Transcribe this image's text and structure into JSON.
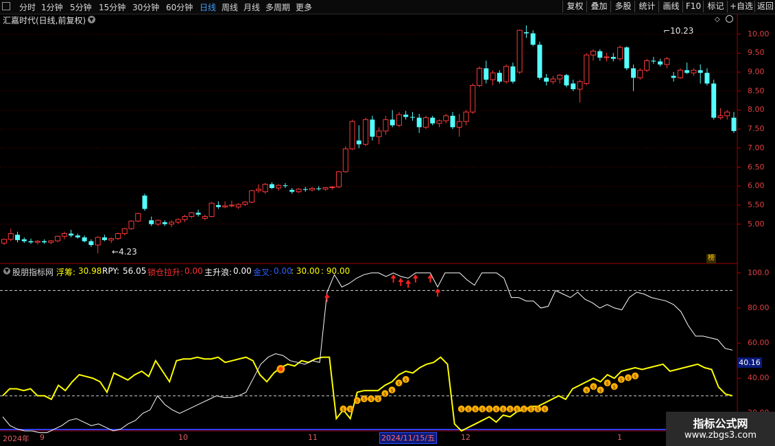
{
  "toolbar": {
    "periods": [
      "分时",
      "1分钟",
      "5分钟",
      "15分钟",
      "30分钟",
      "60分钟",
      "日线",
      "周线",
      "月线",
      "多周期",
      "更多"
    ],
    "active": "日线",
    "buttons": [
      "复权",
      "叠加",
      "多股",
      "统计",
      "画线",
      "F10",
      "标记",
      "+自选",
      "返回"
    ]
  },
  "main_chart": {
    "title": "汇嘉时代(日线,前复权)",
    "high_label": "10.23",
    "low_label": "4.23",
    "badge": "榜",
    "y_ticks": [
      "10.00",
      "9.50",
      "9.00",
      "8.50",
      "8.00",
      "7.50",
      "7.00",
      "6.50",
      "6.00",
      "5.50",
      "5.00"
    ]
  },
  "indicator": {
    "name": "股朋指标网",
    "fuchou_label": "浮筹:",
    "fuchou_value": "30.98",
    "rpy_label": "RPY:",
    "rpy_value": "56.05",
    "suocang_label": "锁仓拉升:",
    "suocang_value": "0.00",
    "zhushenglang_label": "主升浪:",
    "zhushenglang_value": "0.00",
    "jincha_label": "金叉:",
    "jincha_value": "0.00",
    "level1": ": 30.00",
    "level2": ": 90.00",
    "y_ticks": [
      "100.0",
      "80.00",
      "60.00",
      "40.00",
      "20.00"
    ],
    "current_value": "40.16"
  },
  "date_axis": {
    "year": "2024年",
    "months": [
      "9",
      "10",
      "11",
      "12",
      "1"
    ],
    "cursor_date": "2024/11/15/五"
  },
  "watermark": {
    "line1": "指标公式网",
    "line2": "www.zbgs3.com"
  },
  "colors": {
    "up": "#ff3a3a",
    "down": "#54ffff",
    "yellow": "#ffff00",
    "white": "#ffffff",
    "axis": "#c00000"
  },
  "chart_data": [
    {
      "type": "candlestick",
      "title": "汇嘉时代(日线,前复权)",
      "ylim": [
        4.0,
        10.5
      ],
      "annotations": {
        "max": 10.23,
        "min": 4.23
      },
      "candles": [
        [
          4.5,
          4.62,
          4.45,
          4.6
        ],
        [
          4.6,
          4.88,
          4.55,
          4.75
        ],
        [
          4.72,
          4.8,
          4.52,
          4.58
        ],
        [
          4.6,
          4.65,
          4.5,
          4.55
        ],
        [
          4.55,
          4.62,
          4.48,
          4.52
        ],
        [
          4.52,
          4.58,
          4.46,
          4.55
        ],
        [
          4.55,
          4.6,
          4.48,
          4.52
        ],
        [
          4.52,
          4.58,
          4.47,
          4.56
        ],
        [
          4.56,
          4.7,
          4.52,
          4.68
        ],
        [
          4.68,
          4.8,
          4.6,
          4.75
        ],
        [
          4.75,
          4.85,
          4.65,
          4.7
        ],
        [
          4.7,
          4.75,
          4.62,
          4.65
        ],
        [
          4.65,
          4.7,
          4.52,
          4.55
        ],
        [
          4.55,
          4.6,
          4.4,
          4.45
        ],
        [
          4.45,
          4.68,
          4.23,
          4.65
        ],
        [
          4.65,
          4.72,
          4.55,
          4.58
        ],
        [
          4.58,
          4.65,
          4.5,
          4.62
        ],
        [
          4.62,
          4.78,
          4.58,
          4.75
        ],
        [
          4.75,
          4.9,
          4.7,
          4.88
        ],
        [
          4.88,
          5.1,
          4.85,
          5.08
        ],
        [
          5.08,
          5.3,
          5.05,
          5.28
        ],
        [
          5.75,
          5.8,
          5.35,
          5.4
        ],
        [
          5.1,
          5.2,
          4.95,
          5.0
        ],
        [
          5.0,
          5.12,
          4.95,
          5.1
        ],
        [
          5.05,
          5.1,
          4.95,
          5.0
        ],
        [
          5.0,
          5.1,
          4.92,
          5.05
        ],
        [
          5.05,
          5.15,
          5.0,
          5.12
        ],
        [
          5.12,
          5.25,
          5.05,
          5.2
        ],
        [
          5.2,
          5.32,
          5.15,
          5.3
        ],
        [
          5.3,
          5.38,
          5.2,
          5.25
        ],
        [
          5.15,
          5.25,
          5.1,
          5.2
        ],
        [
          5.2,
          5.58,
          5.18,
          5.55
        ],
        [
          5.5,
          5.6,
          5.4,
          5.45
        ],
        [
          5.45,
          5.6,
          5.42,
          5.48
        ],
        [
          5.48,
          5.62,
          5.44,
          5.5
        ],
        [
          5.45,
          5.55,
          5.4,
          5.52
        ],
        [
          5.52,
          5.6,
          5.48,
          5.58
        ],
        [
          5.58,
          5.9,
          5.55,
          5.88
        ],
        [
          5.88,
          6.05,
          5.82,
          5.92
        ],
        [
          5.85,
          6.08,
          5.8,
          6.05
        ],
        [
          6.05,
          6.1,
          5.92,
          5.95
        ],
        [
          5.95,
          6.05,
          5.88,
          6.02
        ],
        [
          6.02,
          6.08,
          5.95,
          6.0
        ],
        [
          5.9,
          5.95,
          5.8,
          5.85
        ],
        [
          5.85,
          5.95,
          5.82,
          5.92
        ],
        [
          5.92,
          5.98,
          5.85,
          5.9
        ],
        [
          5.9,
          5.98,
          5.86,
          5.94
        ],
        [
          5.94,
          6.0,
          5.88,
          5.92
        ],
        [
          5.92,
          5.98,
          5.88,
          5.96
        ],
        [
          5.96,
          6.0,
          5.9,
          5.98
        ],
        [
          5.98,
          6.4,
          5.95,
          6.38
        ],
        [
          6.38,
          7.05,
          6.35,
          6.98
        ],
        [
          6.98,
          7.75,
          6.95,
          7.7
        ],
        [
          7.2,
          7.6,
          7.0,
          7.1
        ],
        [
          7.1,
          7.8,
          7.05,
          7.75
        ],
        [
          7.75,
          7.85,
          7.2,
          7.3
        ],
        [
          7.3,
          7.55,
          7.1,
          7.45
        ],
        [
          7.45,
          7.85,
          7.35,
          7.75
        ],
        [
          7.75,
          8.0,
          7.55,
          7.6
        ],
        [
          7.6,
          7.95,
          7.55,
          7.88
        ],
        [
          7.88,
          7.98,
          7.75,
          7.82
        ],
        [
          7.82,
          7.95,
          7.72,
          7.8
        ],
        [
          7.8,
          7.9,
          7.4,
          7.55
        ],
        [
          7.55,
          7.85,
          7.5,
          7.8
        ],
        [
          7.8,
          7.85,
          7.6,
          7.65
        ],
        [
          7.65,
          7.75,
          7.55,
          7.72
        ],
        [
          7.72,
          7.9,
          7.65,
          7.85
        ],
        [
          7.85,
          7.95,
          7.5,
          7.55
        ],
        [
          7.55,
          7.9,
          7.3,
          7.7
        ],
        [
          7.7,
          8.0,
          7.6,
          7.95
        ],
        [
          7.95,
          8.7,
          7.9,
          8.65
        ],
        [
          8.65,
          9.15,
          8.6,
          9.1
        ],
        [
          9.1,
          9.3,
          8.7,
          8.8
        ],
        [
          8.8,
          9.05,
          8.65,
          8.98
        ],
        [
          8.98,
          9.05,
          8.7,
          8.75
        ],
        [
          8.75,
          9.2,
          8.7,
          9.15
        ],
        [
          9.15,
          9.25,
          8.7,
          8.75
        ],
        [
          9.0,
          10.12,
          8.95,
          10.1
        ],
        [
          10.05,
          10.23,
          9.9,
          10.02
        ],
        [
          10.02,
          10.1,
          9.68,
          9.72
        ],
        [
          9.72,
          9.8,
          8.8,
          8.85
        ],
        [
          8.85,
          8.95,
          8.65,
          8.75
        ],
        [
          8.75,
          8.9,
          8.68,
          8.82
        ],
        [
          8.82,
          8.95,
          8.7,
          8.92
        ],
        [
          8.92,
          8.95,
          8.6,
          8.65
        ],
        [
          8.7,
          8.8,
          8.5,
          8.55
        ],
        [
          8.55,
          8.8,
          8.2,
          8.75
        ],
        [
          8.7,
          9.5,
          8.65,
          9.45
        ],
        [
          9.45,
          9.6,
          9.3,
          9.55
        ],
        [
          9.55,
          9.6,
          9.3,
          9.38
        ],
        [
          9.38,
          9.5,
          9.28,
          9.4
        ],
        [
          9.4,
          9.5,
          9.28,
          9.35
        ],
        [
          9.35,
          9.7,
          9.3,
          9.65
        ],
        [
          9.65,
          9.68,
          9.05,
          9.1
        ],
        [
          9.1,
          9.2,
          8.5,
          8.85
        ],
        [
          8.85,
          9.1,
          8.8,
          9.05
        ],
        [
          9.05,
          9.35,
          9.0,
          9.3
        ],
        [
          9.3,
          9.4,
          9.22,
          9.28
        ],
        [
          9.28,
          9.35,
          9.15,
          9.2
        ],
        [
          9.2,
          9.4,
          9.1,
          9.35
        ],
        [
          8.9,
          9.0,
          8.75,
          8.85
        ],
        [
          8.85,
          9.1,
          8.82,
          9.05
        ],
        [
          9.05,
          9.25,
          8.95,
          8.98
        ],
        [
          8.98,
          9.1,
          8.9,
          9.05
        ],
        [
          9.05,
          9.2,
          8.7,
          8.98
        ],
        [
          8.98,
          9.1,
          8.65,
          8.7
        ],
        [
          8.7,
          8.8,
          7.75,
          7.8
        ],
        [
          7.8,
          8.05,
          7.75,
          7.85
        ],
        [
          7.85,
          8.0,
          7.75,
          7.95
        ],
        [
          7.8,
          7.95,
          7.4,
          7.45
        ]
      ]
    },
    {
      "type": "line",
      "title": "股朋指标网",
      "ylim": [
        10,
        105
      ],
      "reference_lines": [
        30,
        90
      ],
      "series": [
        {
          "name": "浮筹",
          "color": "#ffff00",
          "values": [
            30,
            34,
            34,
            33,
            34,
            30,
            30,
            28,
            36,
            33,
            38,
            42,
            41,
            40,
            38,
            32,
            43,
            41,
            39,
            42,
            44,
            41,
            50,
            44,
            38,
            50,
            51,
            51,
            52,
            51,
            51,
            52,
            49,
            50,
            51,
            52,
            50,
            42,
            38,
            43,
            46,
            48,
            47,
            50,
            49,
            51,
            52,
            52,
            17,
            22,
            17,
            32,
            33,
            33,
            33,
            36,
            38,
            42,
            44,
            43,
            46,
            48,
            49,
            52,
            48,
            14,
            10,
            12,
            14,
            16,
            18,
            15,
            19,
            18,
            21,
            22,
            24,
            24,
            26,
            28,
            30,
            28,
            34,
            36,
            38,
            40,
            38,
            42,
            40,
            44,
            45,
            46,
            45,
            46,
            47,
            48,
            44,
            45,
            46,
            47,
            48,
            46,
            45,
            35,
            31,
            30
          ],
          "markers": {
            "coin_bag_start": [
              49,
              58
            ],
            "coin_bag_mid": [
              66,
              78
            ],
            "coin_bag_late": [
              84,
              91
            ],
            "gold_circle": 40
          }
        },
        {
          "name": "RPY",
          "color": "#ffffff",
          "values": [
            18,
            13,
            11,
            10,
            10,
            9,
            9,
            11,
            13,
            16,
            17,
            15,
            13,
            14,
            12,
            10,
            11,
            14,
            16,
            20,
            22,
            30,
            25,
            22,
            20,
            22,
            24,
            26,
            28,
            30,
            29,
            29,
            30,
            32,
            40,
            48,
            52,
            54,
            53,
            50,
            49,
            48,
            50,
            49,
            89,
            99,
            92,
            94,
            97,
            99,
            100,
            100,
            98,
            100,
            98,
            97,
            100,
            100,
            100,
            92,
            100,
            100,
            100,
            96,
            93,
            100,
            100,
            100,
            97,
            86,
            86,
            84,
            84,
            80,
            81,
            90,
            88,
            86,
            89,
            85,
            83,
            80,
            82,
            80,
            79,
            86,
            89,
            88,
            86,
            85,
            84,
            82,
            78,
            70,
            64,
            64,
            63,
            62,
            57,
            56
          ],
          "markers": {
            "red_arrow": [
              44,
              53,
              54,
              55,
              56,
              58,
              59
            ]
          }
        }
      ]
    }
  ]
}
